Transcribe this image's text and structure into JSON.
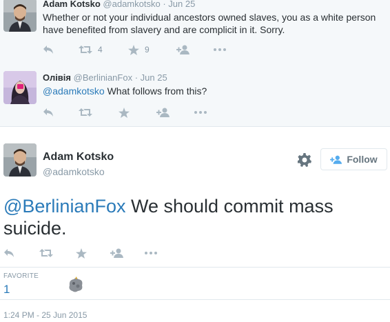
{
  "replies": [
    {
      "name": "Adam Kotsko",
      "handle": "@adamkotsko",
      "date": "· Jun 25",
      "text": "Whether or not your individual ancestors owned slaves, you as a white person have benefited from slavery and are complicit in it. Sorry.",
      "retweets": "4",
      "favorites": "9"
    },
    {
      "name": "Олівія",
      "handle": "@BerlinianFox",
      "date": "· Jun 25",
      "mention": "@adamkotsko",
      "text": " What follows from this?"
    }
  ],
  "main": {
    "name": "Adam Kotsko",
    "handle": "@adamkotsko",
    "follow_label": "Follow",
    "mention": "@BerlinianFox",
    "text_line1": " We should commit mass",
    "text_line2": "suicide.",
    "favorite_label": "FAVORITE",
    "favorite_count": "1",
    "timestamp": "1:24 PM - 25 Jun 2015"
  },
  "icons": {
    "reply": "reply-icon",
    "retweet": "retweet-icon",
    "favorite": "star-icon",
    "follow": "follow-user-icon",
    "more": "more-icon",
    "settings": "gear-icon"
  },
  "colors": {
    "link": "#2b7bb9",
    "muted": "#8899a6",
    "icon": "#aab8c2",
    "reply_bg": "#f5f8fa"
  }
}
